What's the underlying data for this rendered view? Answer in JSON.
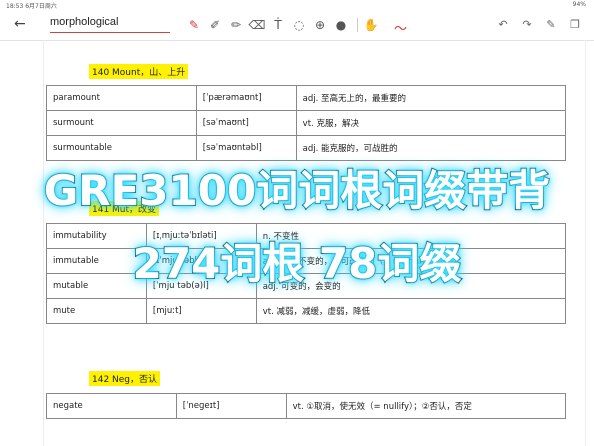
{
  "status": {
    "time": "18:53",
    "date": "6月7日周六",
    "battery": "94%"
  },
  "toolbar": {
    "back_icon": "←",
    "title": "morphological",
    "tools": [
      "pen-icon",
      "pen2-icon",
      "highlighter-icon",
      "eraser-icon",
      "text-icon",
      "lasso-icon",
      "add-icon",
      "mic-icon",
      "hand-icon"
    ],
    "squiggle": "〜",
    "right_tools": [
      "undo-icon",
      "redo-icon",
      "edit-icon",
      "pages-icon"
    ]
  },
  "sections": [
    {
      "title": "140 Mount，山、上升",
      "rows": [
        [
          "paramount",
          "[ˈpærəmaʊnt]",
          "adj. 至高无上的，最重要的"
        ],
        [
          "surmount",
          "[səˈmaʊnt]",
          "vt. 克服，解决"
        ],
        [
          "surmountable",
          "[səˈmaʊntəbl]",
          "adj. 能克服的，可战胜的"
        ]
      ]
    },
    {
      "title": "141 Mut，改变",
      "rows": [
        [
          "immutability",
          "[ɪˌmjuːtəˈbɪləti]",
          "n. 不变性"
        ],
        [
          "immutable",
          "[ɪˈmjuːtəbl]",
          "adj. 永恒不变的，不可改变的（= unchangeable）"
        ],
        [
          "mutable",
          "[ˈmju təb(ə)l]",
          "adj. 可变的，会变的"
        ],
        [
          "mute",
          "[mjuːt]",
          "vt. 减弱，减缓，虚弱，降低"
        ]
      ]
    },
    {
      "title": "142 Neg，否认",
      "rows": [
        [
          "negate",
          "[ˈneɡeɪt]",
          "vt. ①取消，使无效（= nullify）；②否认，否定"
        ]
      ]
    }
  ],
  "overlay": {
    "line1": "GRE3100词词根词缀带背",
    "line2": "274词根 78词缀"
  }
}
